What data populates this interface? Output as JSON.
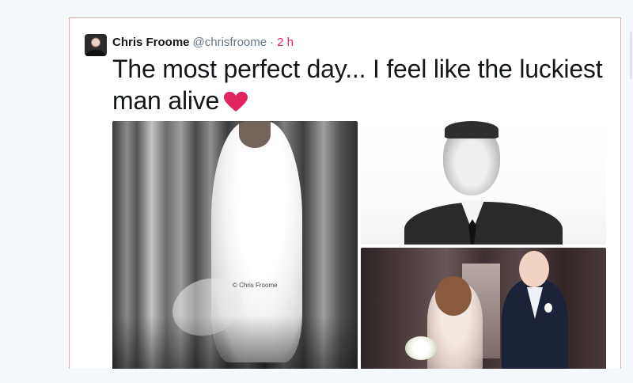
{
  "tweet": {
    "author": {
      "display_name": "Chris Froome",
      "handle": "@chrisfroome"
    },
    "separator": "·",
    "timestamp": "2 h",
    "text": "The most perfect day... I feel like the luckiest man alive",
    "emoji": "heart-icon",
    "media": [
      {
        "name": "photo-bride-dress",
        "watermark": "© Chris Froome"
      },
      {
        "name": "photo-groom-portrait"
      },
      {
        "name": "photo-couple"
      }
    ]
  },
  "colors": {
    "page_background": "#f5f8fa",
    "card_border": "#e8a9a9",
    "name_text": "#14171a",
    "handle_text": "#657786",
    "timestamp": "#e0245e",
    "heart": "#e0245e"
  }
}
